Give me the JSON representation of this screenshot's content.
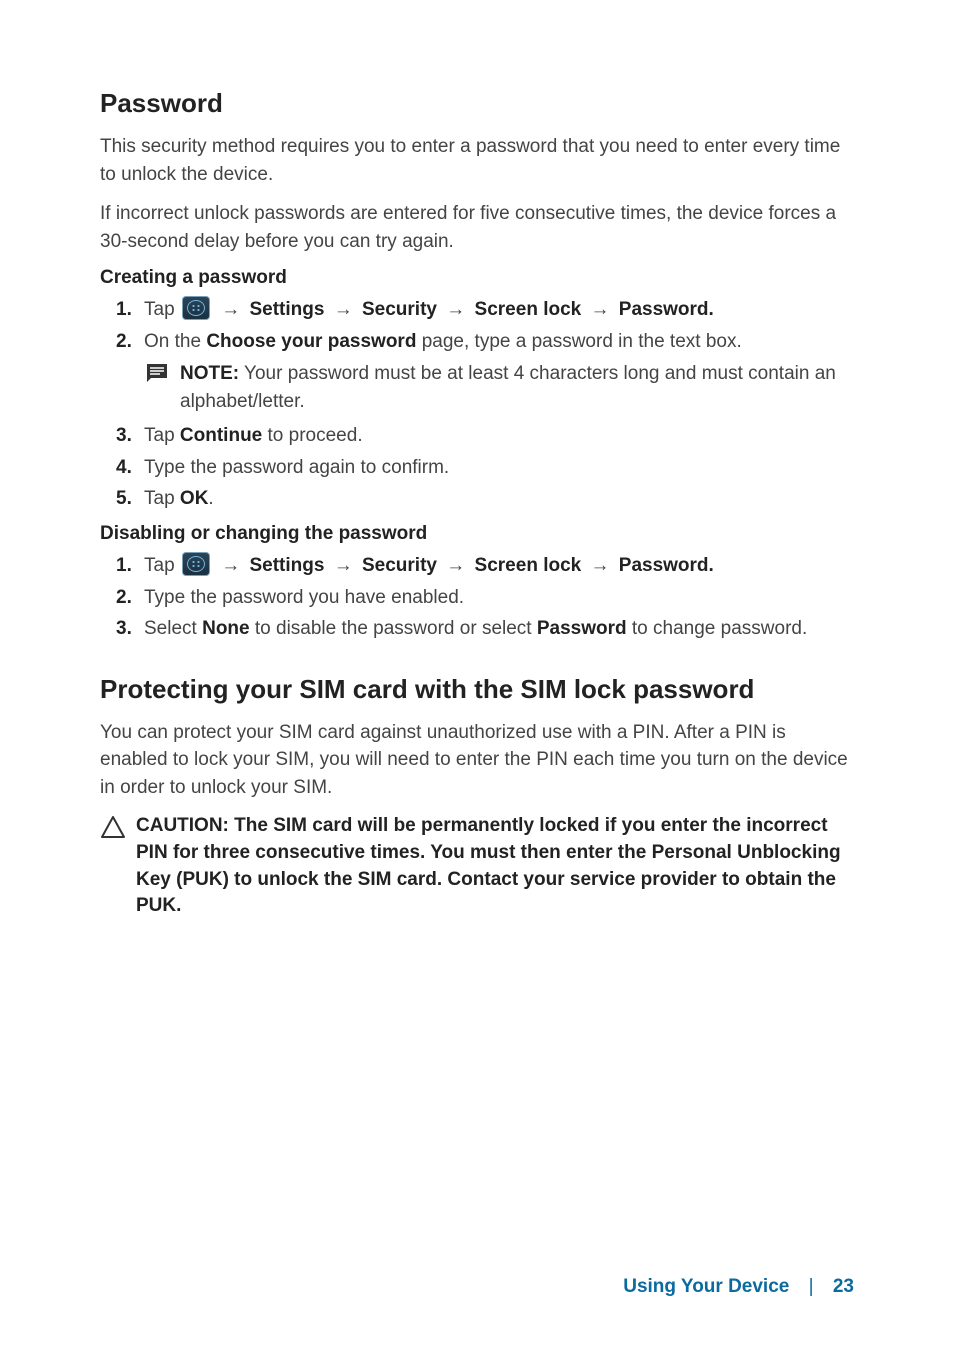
{
  "section1": {
    "title": "Password",
    "intro1": "This security method requires you to enter a password that you need to enter every time to unlock the device.",
    "intro2": "If incorrect unlock passwords are entered for five consecutive times, the device forces a 30-second delay before you can try again.",
    "create_heading": "Creating a password",
    "nav_settings": "Settings",
    "nav_security": "Security",
    "nav_screenlock": "Screen lock",
    "nav_password": "Password",
    "step1_pre": "Tap ",
    "arrow": "→",
    "step2_pre": "On the ",
    "step2_bold": "Choose your password",
    "step2_post": " page, type a password in the text box.",
    "note_label": "NOTE:",
    "note_text": " Your password must be at least 4 characters long and must contain an alphabet/letter.",
    "step3_pre": "Tap ",
    "step3_bold": "Continue",
    "step3_post": " to proceed.",
    "step4": "Type the password again to confirm.",
    "step5_pre": "Tap ",
    "step5_bold": "OK",
    "step5_post": ".",
    "disable_heading": "Disabling or changing the password",
    "d_step2": "Type the password you have enabled.",
    "d_step3_pre": "Select ",
    "d_step3_b1": "None",
    "d_step3_mid": " to disable the password or select ",
    "d_step3_b2": "Password",
    "d_step3_post": " to change password."
  },
  "section2": {
    "title": "Protecting your SIM card with the SIM lock password",
    "intro": "You can protect your SIM card against unauthorized use with a PIN. After a PIN is enabled to lock your SIM, you will need to enter the PIN each time you turn on the device in order to unlock your SIM.",
    "caution": "CAUTION: The SIM card will be permanently locked if you enter the incorrect PIN for three consecutive times. You must then enter the Personal Unblocking Key (PUK) to unlock the SIM card. Contact your service provider to obtain the PUK."
  },
  "footer": {
    "label": "Using Your Device",
    "page": "23"
  },
  "nums": {
    "n1": "1.",
    "n2": "2.",
    "n3": "3.",
    "n4": "4.",
    "n5": "5."
  }
}
